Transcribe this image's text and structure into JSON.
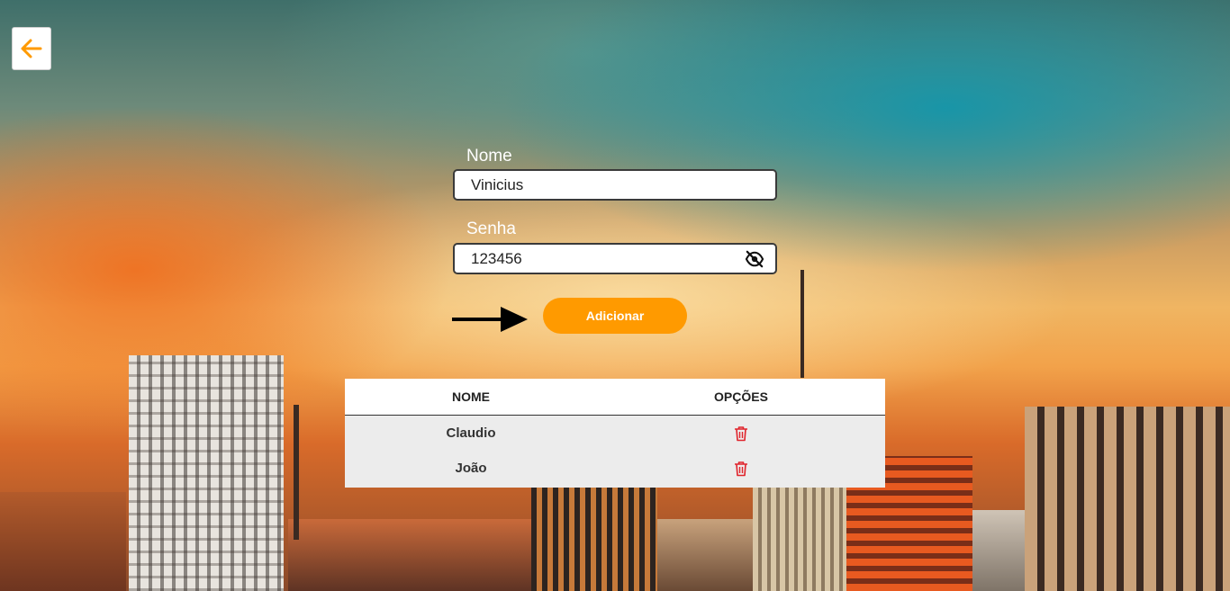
{
  "nav": {
    "back_icon": "arrow-left-icon"
  },
  "form": {
    "name_label": "Nome",
    "name_value": "Vinicius",
    "password_label": "Senha",
    "password_value": "123456",
    "password_toggle_icon": "eye-off-icon",
    "add_button_label": "Adicionar"
  },
  "table": {
    "headers": [
      "NOME",
      "OPÇÕES"
    ],
    "rows": [
      {
        "name": "Claudio",
        "action_icon": "trash-icon"
      },
      {
        "name": "João",
        "action_icon": "trash-icon"
      }
    ]
  },
  "colors": {
    "accent": "#ff9a00",
    "delete": "#e0242c",
    "row_background": "#ececec"
  }
}
